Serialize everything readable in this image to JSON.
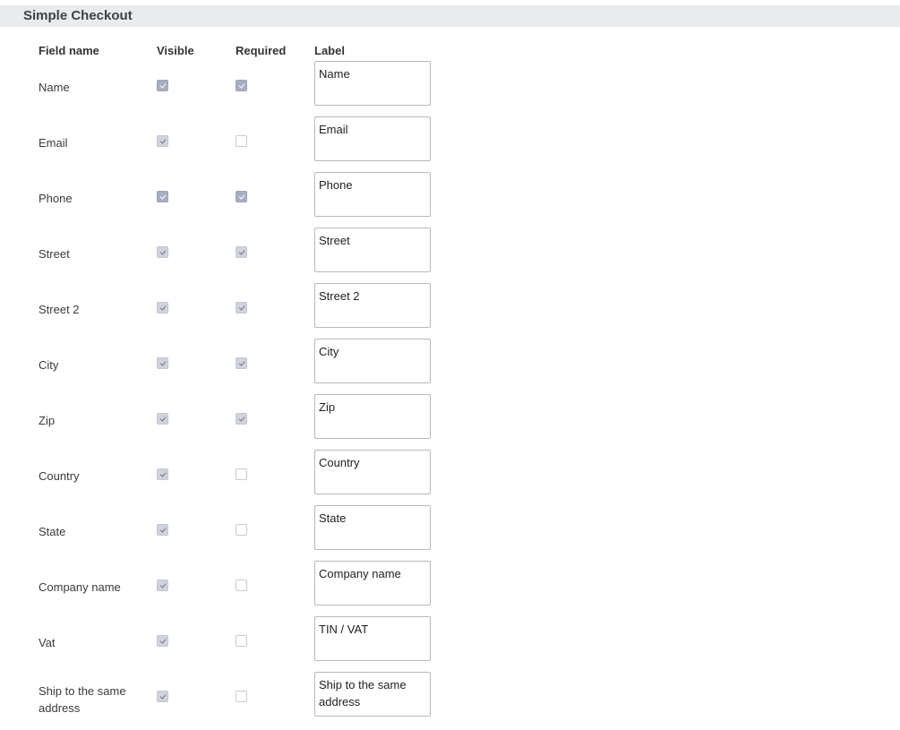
{
  "header": {
    "title": "Simple Checkout"
  },
  "columns": {
    "field_name": "Field name",
    "visible": "Visible",
    "required": "Required",
    "label": "Label"
  },
  "rows": [
    {
      "field": "Name",
      "visible": true,
      "required": true,
      "label": "Name"
    },
    {
      "field": "Email",
      "visible": true,
      "required": false,
      "label": "Email"
    },
    {
      "field": "Phone",
      "visible": true,
      "required": true,
      "label": "Phone"
    },
    {
      "field": "Street",
      "visible": true,
      "required": true,
      "label": "Street"
    },
    {
      "field": "Street 2",
      "visible": true,
      "required": true,
      "label": "Street 2"
    },
    {
      "field": "City",
      "visible": true,
      "required": true,
      "label": "City"
    },
    {
      "field": "Zip",
      "visible": true,
      "required": true,
      "label": "Zip"
    },
    {
      "field": "Country",
      "visible": true,
      "required": false,
      "label": "Country"
    },
    {
      "field": "State",
      "visible": true,
      "required": false,
      "label": "State"
    },
    {
      "field": "Company name",
      "visible": true,
      "required": false,
      "label": "Company name"
    },
    {
      "field": "Vat",
      "visible": true,
      "required": false,
      "label": "TIN / VAT"
    },
    {
      "field": "Ship to the same address",
      "visible": true,
      "required": false,
      "label": "Ship to the same address"
    }
  ]
}
